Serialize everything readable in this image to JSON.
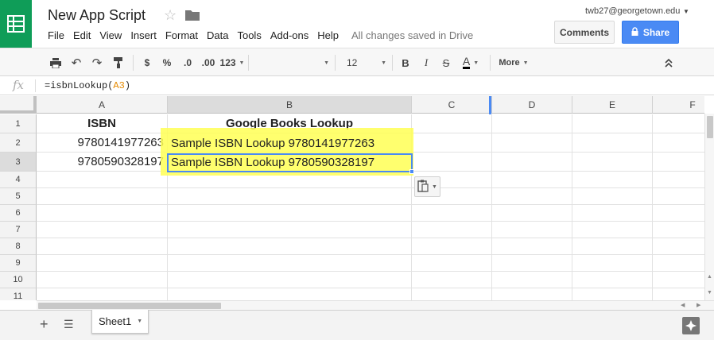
{
  "header": {
    "doc_title": "New App Script",
    "user_email": "twb27@georgetown.edu",
    "menu": [
      "File",
      "Edit",
      "View",
      "Insert",
      "Format",
      "Data",
      "Tools",
      "Add-ons",
      "Help"
    ],
    "save_status": "All changes saved in Drive",
    "comments_label": "Comments",
    "share_label": "Share"
  },
  "toolbar": {
    "currency": "$",
    "percent": "%",
    "decrease_decimals": ".0",
    "increase_decimals": ".00",
    "more_formats": "123",
    "font_size": "12",
    "bold": "B",
    "italic": "I",
    "strikethrough": "S",
    "text_color": "A",
    "more_label": "More",
    "text_color_value": "#000000"
  },
  "formula_bar": {
    "fx": "fx",
    "formula_prefix": "=isbnLookup(",
    "formula_ref": "A3",
    "formula_suffix": ")"
  },
  "grid": {
    "columns": [
      "A",
      "B",
      "C",
      "D",
      "E",
      "F"
    ],
    "rows": [
      "1",
      "2",
      "3",
      "4",
      "5",
      "6",
      "7",
      "8",
      "9",
      "10",
      "11"
    ],
    "cells": {
      "A1": "ISBN",
      "B1": "Google Books Lookup",
      "A2": "9780141977263",
      "B2": "Sample ISBN Lookup 9780141977263",
      "A3": "9780590328197",
      "B3": "Sample ISBN Lookup 9780590328197"
    },
    "active_cell": "B3",
    "highlight_color": "#ffff55"
  },
  "bottom": {
    "sheet_tab": "Sheet1"
  },
  "colors": {
    "brand": "#0f9d58",
    "share": "#4a8af4",
    "selection": "#4a8af4"
  }
}
